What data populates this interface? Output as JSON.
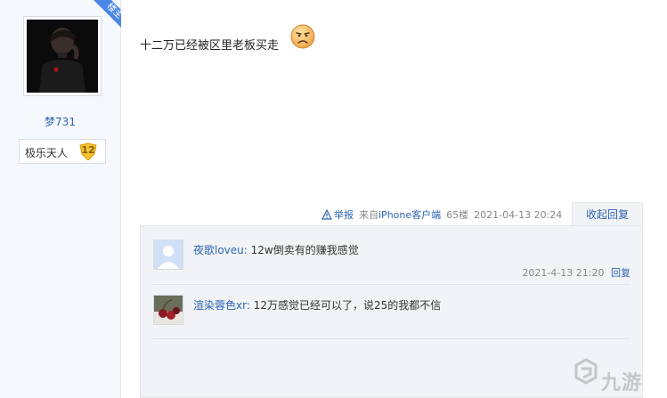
{
  "author": {
    "badge": "楼主",
    "username": "梦731",
    "level_name": "极乐天人",
    "level": "12"
  },
  "post": {
    "text": "十二万已经被区里老板买走",
    "emoji_icon": "frown-face-emoji"
  },
  "tail": {
    "report_label": "举报",
    "from_prefix": "来自",
    "from_client": "iPhone客户端",
    "floor": "65楼",
    "time": "2021-04-13 20:24",
    "collapse_label": "收起回复"
  },
  "replies": [
    {
      "name": "夜歌loveu:",
      "text": "12w倒卖有的赚我感觉",
      "time": "2021-4-13 21:20",
      "reply_label": "回复",
      "avatar_icon": "default-avatar-icon"
    },
    {
      "name": "渲染蓉色xr:",
      "text": "12万感觉已经可以了，说25的我都不信",
      "avatar_icon": "cherries-avatar"
    }
  ],
  "watermark": {
    "logo_text": "九游"
  },
  "colors": {
    "link": "#2d64b3",
    "ribbon": "#4a86e8",
    "panel": "#f1f3f6",
    "sidebar": "#f5f8fd"
  }
}
